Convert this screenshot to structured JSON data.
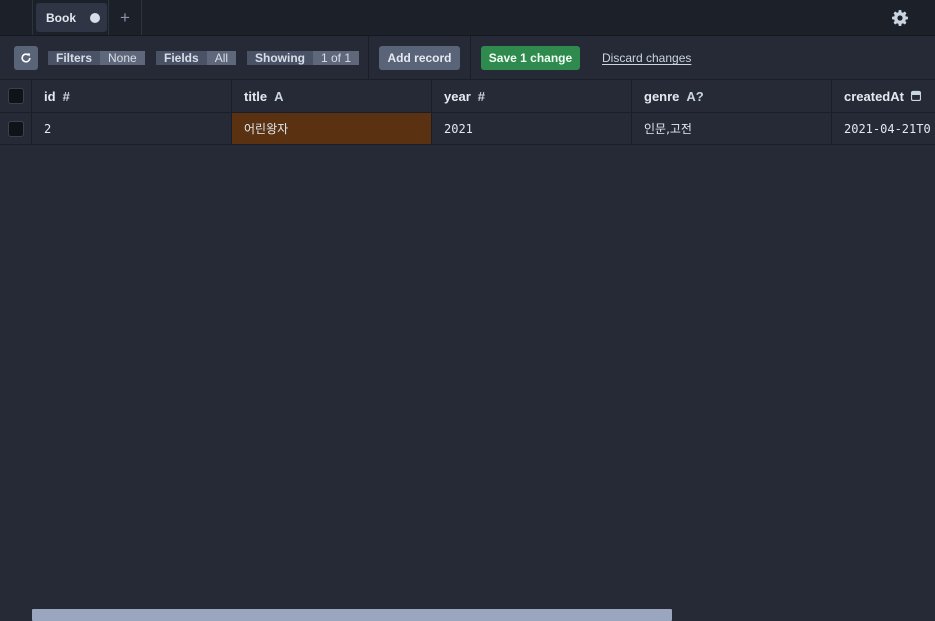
{
  "tabs": [
    {
      "label": "Book",
      "unsaved": true
    }
  ],
  "toolbar": {
    "filters_label": "Filters",
    "filters_value": "None",
    "fields_label": "Fields",
    "fields_value": "All",
    "showing_label": "Showing",
    "showing_value": "1 of 1",
    "add_record_label": "Add record",
    "save_label": "Save 1 change",
    "discard_label": "Discard changes"
  },
  "columns": [
    {
      "name": "id",
      "type_icon": "#"
    },
    {
      "name": "title",
      "type_icon": "A"
    },
    {
      "name": "year",
      "type_icon": "#"
    },
    {
      "name": "genre",
      "type_icon": "A?"
    },
    {
      "name": "createdAt",
      "type_icon": "calendar-icon"
    }
  ],
  "rows": [
    {
      "id": "2",
      "title": "어린왕자",
      "year": "2021",
      "genre": "인문,고전",
      "createdAt": "2021-04-21T0"
    }
  ],
  "colors": {
    "save": "#2f8a4e",
    "changed_cell": "#5a3212",
    "background": "#252a36"
  }
}
